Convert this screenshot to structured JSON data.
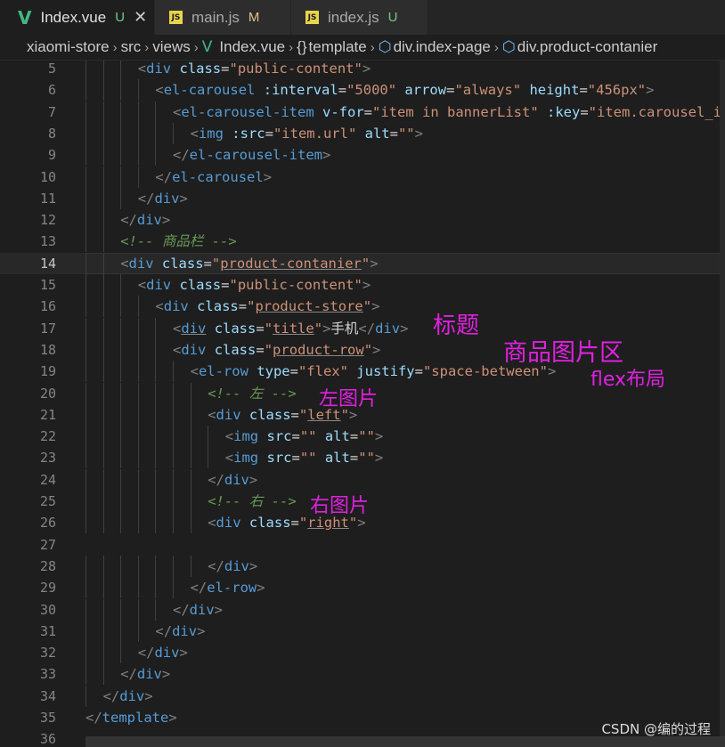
{
  "tabs": [
    {
      "label": "Index.vue",
      "icon": "vue-icon",
      "status": "U",
      "active": true,
      "closable": true
    },
    {
      "label": "main.js",
      "icon": "js-icon",
      "status": "M",
      "active": false,
      "closable": false
    },
    {
      "label": "index.js",
      "icon": "js-icon",
      "status": "U",
      "active": false,
      "closable": false
    }
  ],
  "icon_glyphs": {
    "vue": "V",
    "js": "JS",
    "close": "✕",
    "braces": "{}",
    "cube": "⬡",
    "chevron": "›"
  },
  "breadcrumb": [
    "xiaomi-store",
    "src",
    "views",
    "Index.vue",
    "template",
    "div.index-page",
    "div.product-contanier"
  ],
  "colors": {
    "annotation": "#e020e0",
    "vue": "#41b883",
    "js": "#e8d44d",
    "status_untracked": "#73c991",
    "status_modified": "#e2c08d"
  },
  "lines": [
    {
      "n": "5",
      "indent": 3,
      "code": "<div class=\"public-content\">"
    },
    {
      "n": "6",
      "indent": 4,
      "code": "<el-carousel :interval=\"5000\" arrow=\"always\" height=\"456px\">"
    },
    {
      "n": "7",
      "indent": 5,
      "code": "<el-carousel-item v-for=\"item in bannerList\" :key=\"item.carousel_id\">"
    },
    {
      "n": "8",
      "indent": 6,
      "code": "<img :src=\"item.url\" alt=\"\">"
    },
    {
      "n": "9",
      "indent": 5,
      "code": "</el-carousel-item>"
    },
    {
      "n": "10",
      "indent": 4,
      "code": "</el-carousel>"
    },
    {
      "n": "11",
      "indent": 3,
      "code": "</div>"
    },
    {
      "n": "12",
      "indent": 2,
      "code": "</div>"
    },
    {
      "n": "13",
      "indent": 2,
      "code": "<!-- 商品栏 -->"
    },
    {
      "n": "14",
      "indent": 2,
      "code": "<div class=\"product-contanier\">"
    },
    {
      "n": "15",
      "indent": 3,
      "code": "<div class=\"public-content\">"
    },
    {
      "n": "16",
      "indent": 4,
      "code": "<div class=\"product-store\">"
    },
    {
      "n": "17",
      "indent": 5,
      "code": "<div class=\"title\">手机</div>"
    },
    {
      "n": "18",
      "indent": 5,
      "code": "<div class=\"product-row\">"
    },
    {
      "n": "19",
      "indent": 6,
      "code": "<el-row type=\"flex\" justify=\"space-between\">"
    },
    {
      "n": "20",
      "indent": 7,
      "code": "<!-- 左 -->"
    },
    {
      "n": "21",
      "indent": 7,
      "code": "<div class=\"left\">"
    },
    {
      "n": "22",
      "indent": 8,
      "code": "<img src=\"\" alt=\"\">"
    },
    {
      "n": "23",
      "indent": 8,
      "code": "<img src=\"\" alt=\"\">"
    },
    {
      "n": "24",
      "indent": 7,
      "code": "</div>"
    },
    {
      "n": "25",
      "indent": 7,
      "code": "<!-- 右 -->"
    },
    {
      "n": "26",
      "indent": 7,
      "code": "<div class=\"right\">"
    },
    {
      "n": "27",
      "indent": 0,
      "code": ""
    },
    {
      "n": "28",
      "indent": 7,
      "code": "</div>"
    },
    {
      "n": "29",
      "indent": 6,
      "code": "</el-row>"
    },
    {
      "n": "30",
      "indent": 5,
      "code": "</div>"
    },
    {
      "n": "31",
      "indent": 4,
      "code": "</div>"
    },
    {
      "n": "32",
      "indent": 3,
      "code": "</div>"
    },
    {
      "n": "33",
      "indent": 2,
      "code": "</div>"
    },
    {
      "n": "34",
      "indent": 1,
      "code": "</div>"
    },
    {
      "n": "35",
      "indent": 0,
      "code": "</template>"
    },
    {
      "n": "36",
      "indent": 0,
      "code": ""
    }
  ],
  "current_line": "14",
  "annotations": [
    {
      "text": "标题"
    },
    {
      "text": "商品图片区"
    },
    {
      "text": "flex布局"
    },
    {
      "text": "左图片"
    },
    {
      "text": "右图片"
    }
  ],
  "watermark": "CSDN @编的过程"
}
